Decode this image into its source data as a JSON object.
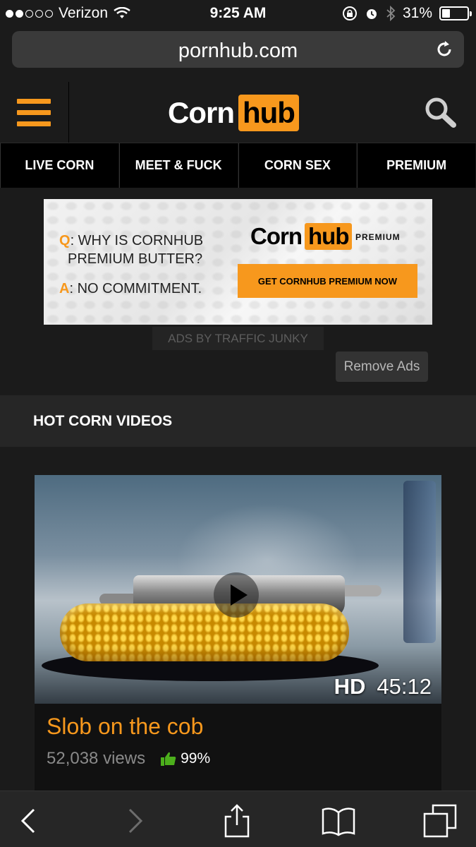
{
  "status_bar": {
    "carrier": "Verizon",
    "time": "9:25 AM",
    "battery": "31%",
    "battery_level": 0.31
  },
  "browser": {
    "url": "pornhub.com"
  },
  "header": {
    "logo_left": "Corn",
    "logo_right": "hub"
  },
  "nav": {
    "items": [
      {
        "label": "LIVE CORN"
      },
      {
        "label": "MEET & FUCK"
      },
      {
        "label": "CORN SEX"
      },
      {
        "label": "PREMIUM"
      }
    ]
  },
  "ad": {
    "q_prefix": "Q",
    "q_line1": ": WHY IS CORNHUB",
    "q_line2": "PREMIUM BUTTER?",
    "a_prefix": "A",
    "a_text": ": NO COMMITMENT.",
    "logo_left": "Corn",
    "logo_right": "hub",
    "premium_label": "PREMIUM",
    "cta": "GET CORNHUB PREMIUM NOW",
    "ads_by": "ADS BY TRAFFIC JUNKY",
    "remove_ads": "Remove Ads"
  },
  "section": {
    "title": "HOT CORN VIDEOS"
  },
  "video": {
    "quality": "HD",
    "duration": "45:12",
    "title": "Slob on the cob",
    "views": "52,038 views",
    "rating": "99%"
  },
  "colors": {
    "accent": "#f7981d",
    "background": "#1b1b1b",
    "nav_bg": "#000000",
    "thumb_up": "#4caf1c"
  }
}
